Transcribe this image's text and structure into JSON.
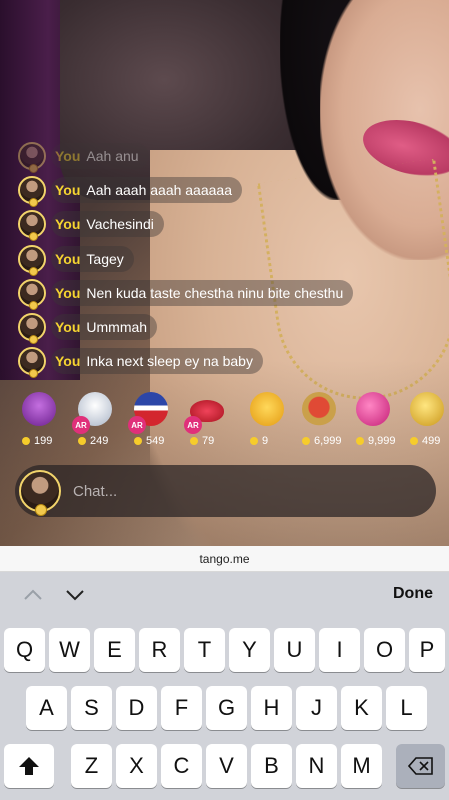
{
  "chat": {
    "messages": [
      {
        "who": "You",
        "text": "Aah anu"
      },
      {
        "who": "You",
        "text": "Aah aaah aaah aaaaaa"
      },
      {
        "who": "You",
        "text": "Vachesindi"
      },
      {
        "who": "You",
        "text": "Tagey"
      },
      {
        "who": "You",
        "text": "Nen kuda taste chestha ninu bite chesthu"
      },
      {
        "who": "You",
        "text": "Ummmah"
      },
      {
        "who": "You",
        "text": "Inka next sleep ey na baby"
      }
    ],
    "input_placeholder": "Chat..."
  },
  "gifts": [
    {
      "icon": "trophy-gift-icon",
      "price": "199",
      "ar": "",
      "color": "#8a3ab0"
    },
    {
      "icon": "star-glasses-gift-icon",
      "price": "249",
      "ar": "AR",
      "color": "#c9d4e4"
    },
    {
      "icon": "uncle-sam-hat-gift-icon",
      "price": "549",
      "ar": "AR",
      "color": "#2c46a8"
    },
    {
      "icon": "lips-gift-icon",
      "price": "79",
      "ar": "AR",
      "color": "#d1283a"
    },
    {
      "icon": "star-face-gift-icon",
      "price": "9",
      "ar": "",
      "color": "#f5b82a"
    },
    {
      "icon": "laurel-medal-gift-icon",
      "price": "6,999",
      "ar": "",
      "color": "#b83026"
    },
    {
      "icon": "hearts-gift-icon",
      "price": "9,999",
      "ar": "",
      "color": "#e2479a"
    },
    {
      "icon": "gold-crown-coin-gift-icon",
      "price": "499",
      "ar": "",
      "color": "#e0b530"
    }
  ],
  "browser": {
    "url": "tango.me"
  },
  "accessory": {
    "done_label": "Done"
  },
  "keyboard": {
    "row1": [
      "Q",
      "W",
      "E",
      "R",
      "T",
      "Y",
      "U",
      "I",
      "O",
      "P"
    ],
    "row2": [
      "A",
      "S",
      "D",
      "F",
      "G",
      "H",
      "J",
      "K",
      "L"
    ],
    "row3": [
      "Z",
      "X",
      "C",
      "V",
      "B",
      "N",
      "M"
    ]
  }
}
